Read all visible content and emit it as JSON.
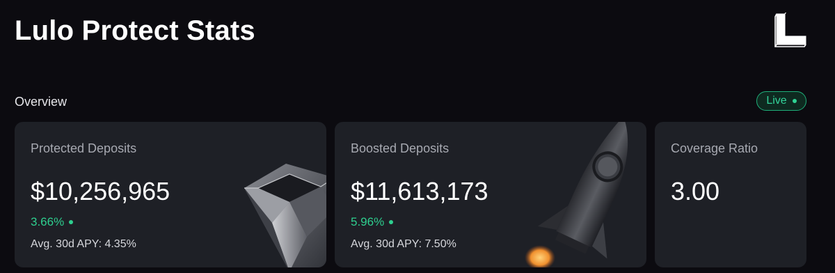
{
  "header": {
    "title": "Lulo Protect Stats",
    "logo_icon": "lulo-logo-icon"
  },
  "overview": {
    "label": "Overview",
    "live_badge": "Live",
    "colors": {
      "background": "#0c0b10",
      "card": "#1e2026",
      "accent_green": "#2ecf8f"
    }
  },
  "cards": [
    {
      "label": "Protected Deposits",
      "value": "$10,256,965",
      "change": "3.66%",
      "apy": "Avg. 30d APY: 4.35%",
      "art_icon": "diamond-icon"
    },
    {
      "label": "Boosted Deposits",
      "value": "$11,613,173",
      "change": "5.96%",
      "apy": "Avg. 30d APY: 7.50%",
      "art_icon": "rocket-icon"
    },
    {
      "label": "Coverage Ratio",
      "value": "3.00"
    }
  ]
}
